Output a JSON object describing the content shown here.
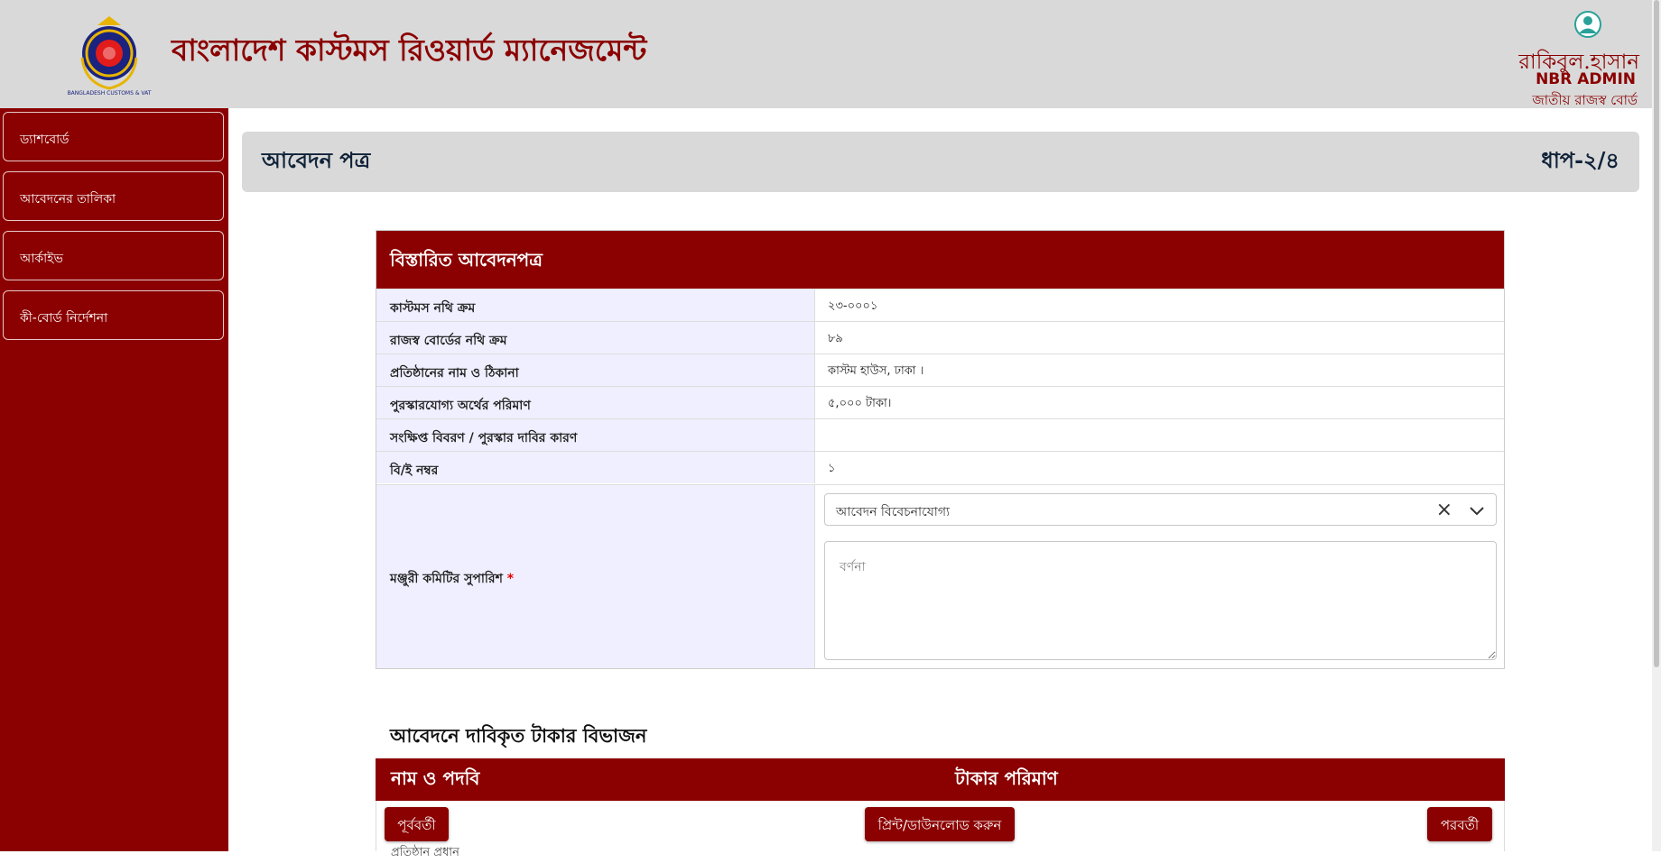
{
  "header": {
    "app_title": "বাংলাদেশ কাস্টমস রিওয়ার্ড ম্যানেজমেন্ট",
    "logo_text": "BANGLADESH CUSTOMS & VAT",
    "user": {
      "name": "রাকিবুল.হাসান",
      "role": "NBR ADMIN",
      "org": "জাতীয় রাজস্ব বোর্ড"
    }
  },
  "sidebar": {
    "items": [
      {
        "label": "ড্যাশবোর্ড"
      },
      {
        "label": "আবেদনের তালিকা"
      },
      {
        "label": "আর্কাইভ"
      },
      {
        "label": "কী-বোর্ড নির্দেশনা"
      }
    ]
  },
  "page": {
    "title": "আবেদন পত্র",
    "step": "ধাপ-২/৪"
  },
  "details": {
    "header": "বিস্তারিত আবেদনপত্র",
    "rows": [
      {
        "label": "কাস্টমস নথি ক্রম",
        "value": "২৩-০০০১"
      },
      {
        "label": "রাজস্ব বোর্ডের নথি ক্রম",
        "value": "৮৯"
      },
      {
        "label": "প্রতিষ্ঠানের নাম ও ঠিকানা",
        "value": "কাস্টম হাউস, ঢাকা ।"
      },
      {
        "label": "পুরস্কারযোগ্য অর্থের পরিমাণ",
        "value": "৫,০০০ টাকা।"
      },
      {
        "label": "সংক্ষিপ্ত বিবরণ / পুরস্কার দাবির কারণ",
        "value": ""
      },
      {
        "label": "বি/ই নম্বর",
        "value": "১"
      }
    ],
    "recommendation": {
      "label": "মঞ্জুরী কমিটির সুপারিশ",
      "required_mark": "*",
      "selected": "আবেদন বিবেচনাযোগ্য",
      "textarea_placeholder": "বর্ণনা"
    }
  },
  "breakdown": {
    "title": "আবেদনে দাবিকৃত টাকার বিভাজন",
    "columns": [
      "নাম ও পদবি",
      "টাকার পরিমাণ"
    ],
    "partial_row": "প্রতিষ্ঠান প্রধান"
  },
  "footer": {
    "prev_label": "পূর্ববর্তী",
    "print_label": "প্রিন্ট/ডাউনলোড করুন",
    "next_label": "পরবর্তী"
  },
  "colors": {
    "brand": "#8b0000",
    "header_bg": "#d9d9d9",
    "label_bg": "#f0efff"
  }
}
